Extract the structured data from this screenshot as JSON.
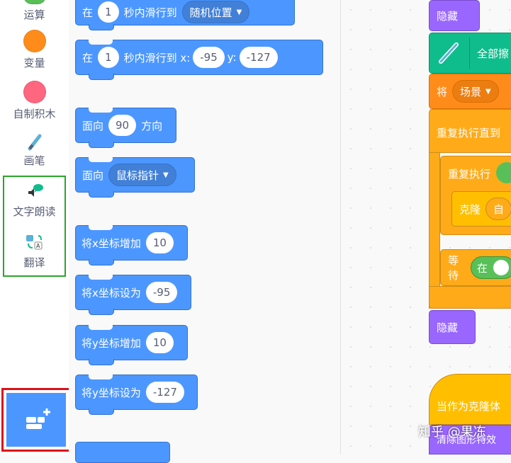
{
  "categories": [
    {
      "label": "运算",
      "color": "#59c059"
    },
    {
      "label": "变量",
      "color": "#ff8c1a"
    },
    {
      "label": "自制积木",
      "color": "#ff6680"
    },
    {
      "label": "画笔"
    },
    {
      "label": "文字朗读"
    },
    {
      "label": "翻译"
    }
  ],
  "palette": {
    "glide_random": {
      "prefix": "在",
      "secs": "1",
      "mid": "秒内滑行到",
      "target": "随机位置"
    },
    "glide_xy": {
      "prefix": "在",
      "secs": "1",
      "mid": "秒内滑行到 x:",
      "x": "-95",
      "ylabel": "y:",
      "y": "-127"
    },
    "point_dir": {
      "prefix": "面向",
      "value": "90",
      "suffix": "方向"
    },
    "point_towards": {
      "prefix": "面向",
      "target": "鼠标指针"
    },
    "change_x": {
      "label": "将x坐标增加",
      "value": "10"
    },
    "set_x": {
      "label": "将x坐标设为",
      "value": "-95"
    },
    "change_y": {
      "label": "将y坐标增加",
      "value": "10"
    },
    "set_y": {
      "label": "将y坐标设为",
      "value": "-127"
    }
  },
  "workspace": {
    "hide1": "隐藏",
    "erase_all": "全部擦",
    "set_var_prefix": "将",
    "set_var_dd": "场景",
    "repeat_until": "重复执行直到",
    "repeat": "重复执行",
    "clone": "克隆",
    "clone_dd": "自",
    "wait": "等待",
    "wait_in": "在",
    "hide2": "隐藏",
    "when_clone": "当作为克隆体",
    "clear_effects": "清除图形特效"
  },
  "watermark": "知乎 @果冻"
}
